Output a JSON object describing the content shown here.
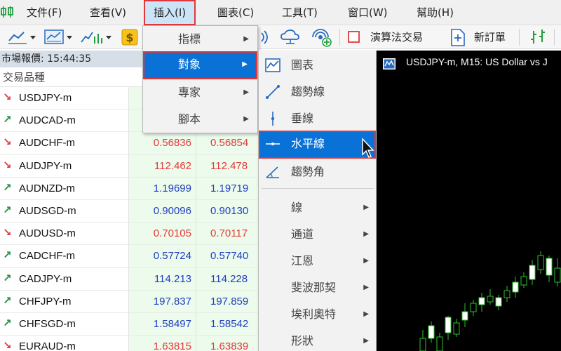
{
  "menubar": {
    "items": [
      {
        "label": "文件(F)"
      },
      {
        "label": "查看(V)"
      },
      {
        "label": "插入(I)"
      },
      {
        "label": "圖表(C)"
      },
      {
        "label": "工具(T)"
      },
      {
        "label": "窗口(W)"
      },
      {
        "label": "幫助(H)"
      }
    ]
  },
  "toolbar": {
    "algo_trading_label": "演算法交易",
    "new_order_label": "新訂單"
  },
  "market_watch": {
    "title": "市場報價: 15:44:35",
    "column_symbol": "交易品種",
    "rows": [
      {
        "direction": "down",
        "symbol": "USDJPY-m",
        "bid": "",
        "ask": "",
        "color": ""
      },
      {
        "direction": "up",
        "symbol": "AUDCAD-m",
        "bid": "",
        "ask": "",
        "color": ""
      },
      {
        "direction": "down",
        "symbol": "AUDCHF-m",
        "bid": "0.56836",
        "ask": "0.56854",
        "color": "red"
      },
      {
        "direction": "down",
        "symbol": "AUDJPY-m",
        "bid": "112.462",
        "ask": "112.478",
        "color": "red"
      },
      {
        "direction": "up",
        "symbol": "AUDNZD-m",
        "bid": "1.19699",
        "ask": "1.19719",
        "color": "blue"
      },
      {
        "direction": "up",
        "symbol": "AUDSGD-m",
        "bid": "0.90096",
        "ask": "0.90130",
        "color": "blue"
      },
      {
        "direction": "down",
        "symbol": "AUDUSD-m",
        "bid": "0.70105",
        "ask": "0.70117",
        "color": "red"
      },
      {
        "direction": "up",
        "symbol": "CADCHF-m",
        "bid": "0.57724",
        "ask": "0.57740",
        "color": "blue"
      },
      {
        "direction": "up",
        "symbol": "CADJPY-m",
        "bid": "114.213",
        "ask": "114.228",
        "color": "blue"
      },
      {
        "direction": "up",
        "symbol": "CHFJPY-m",
        "bid": "197.837",
        "ask": "197.859",
        "color": "blue"
      },
      {
        "direction": "up",
        "symbol": "CHFSGD-m",
        "bid": "1.58497",
        "ask": "1.58542",
        "color": "blue"
      },
      {
        "direction": "down",
        "symbol": "EURAUD-m",
        "bid": "1.63815",
        "ask": "1.63839",
        "color": "red"
      }
    ]
  },
  "insert_menu": {
    "items": [
      {
        "label": "指標"
      },
      {
        "label": "對象"
      },
      {
        "label": "專家"
      },
      {
        "label": "腳本"
      }
    ]
  },
  "objects_menu": {
    "items": [
      {
        "label": "圖表",
        "icon": "chart-line-icon"
      },
      {
        "label": "趨勢線",
        "icon": "trendline-icon"
      },
      {
        "label": "垂線",
        "icon": "vertical-line-icon"
      },
      {
        "label": "水平線",
        "icon": "horizontal-line-icon"
      },
      {
        "label": "趨勢角",
        "icon": "trend-angle-icon"
      },
      {
        "label": "線"
      },
      {
        "label": "通道"
      },
      {
        "label": "江恩"
      },
      {
        "label": "斐波那契"
      },
      {
        "label": "埃利奧特"
      },
      {
        "label": "形狀"
      }
    ]
  },
  "chart": {
    "title": "USDJPY-m, M15:  US Dollar vs J"
  },
  "colors": {
    "selection": "#0a72d6",
    "highlight_border": "#e0383a",
    "bid_red": "#e23b3b",
    "bid_blue": "#1f3fbf",
    "candle": "#2fbf2f"
  }
}
